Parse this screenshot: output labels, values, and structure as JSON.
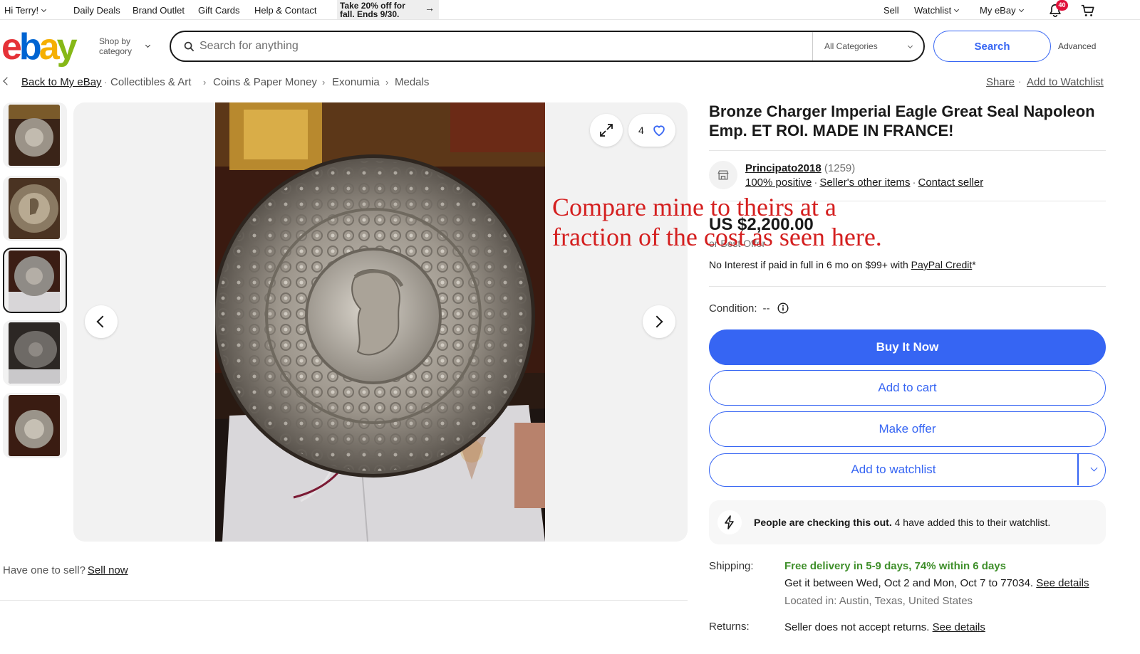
{
  "topbar": {
    "greeting": "Hi Terry!",
    "nav": [
      "Daily Deals",
      "Brand Outlet",
      "Gift Cards",
      "Help & Contact"
    ],
    "promo_line1": "Take 20% off for",
    "promo_line2": "fall. Ends 9/30.",
    "sell": "Sell",
    "watchlist": "Watchlist",
    "myebay": "My eBay",
    "notif_count": "40"
  },
  "header": {
    "shop_by_line1": "Shop by",
    "shop_by_line2": "category",
    "search_placeholder": "Search for anything",
    "category": "All Categories",
    "search_button": "Search",
    "advanced": "Advanced"
  },
  "breadcrumb": {
    "back": "Back to My eBay",
    "items": [
      "Collectibles & Art",
      "Coins & Paper Money",
      "Exonumia",
      "Medals"
    ],
    "share": "Share",
    "add_to_watchlist": "Add to Watchlist"
  },
  "gallery": {
    "watch_count": "4"
  },
  "sell_prompt": {
    "text": "Have one to sell?",
    "link": "Sell now"
  },
  "item": {
    "title": "Bronze Charger Imperial Eagle Great Seal Napoleon Emp. ET ROI. MADE IN FRANCE!",
    "seller_name": "Principato2018",
    "seller_feedback": "(1259)",
    "seller_positive": "100% positive",
    "seller_other_items": "Seller's other items",
    "contact_seller": "Contact seller",
    "price": "US $2,200.00",
    "best_offer": "or Best Offer",
    "credit_text": "No Interest if paid in full in 6 mo on $99+ with",
    "credit_link": "PayPal Credit",
    "credit_suffix": "*",
    "condition_label": "Condition:",
    "condition_value": "--",
    "buy_now": "Buy It Now",
    "add_to_cart": "Add to cart",
    "make_offer": "Make offer",
    "add_to_watchlist": "Add to watchlist",
    "hot_bold": "People are checking this out.",
    "hot_rest": " 4 have added this to their watchlist.",
    "shipping_label": "Shipping:",
    "shipping_free": "Free delivery in 5-9 days, 74% within 6 days",
    "shipping_dates": "Get it between Wed, Oct 2 and Mon, Oct 7 to 77034.",
    "shipping_details": "See details",
    "located": "Located in: Austin, Texas, United States",
    "returns_label": "Returns:",
    "returns_text": "Seller does not accept returns.",
    "returns_details": "See details"
  },
  "overlay": {
    "line1": "Compare mine to theirs at a",
    "line2": "fraction of the cost as seen here."
  },
  "colors": {
    "accent": "#3665f3",
    "overlay_text": "#d41f1f",
    "shipping_green": "#3f8f2b"
  }
}
